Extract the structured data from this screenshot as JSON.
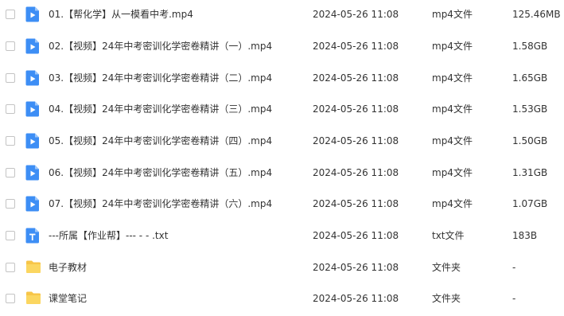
{
  "files": [
    {
      "name": "01.【帮化学】从一模看中考.mp4",
      "date": "2024-05-26 11:08",
      "type": "mp4文件",
      "size": "125.46MB",
      "icon": "video-file-icon"
    },
    {
      "name": "02.【视频】24年中考密训化学密卷精讲（一）.mp4",
      "date": "2024-05-26 11:08",
      "type": "mp4文件",
      "size": "1.58GB",
      "icon": "video-file-icon"
    },
    {
      "name": "03.【视频】24年中考密训化学密卷精讲（二）.mp4",
      "date": "2024-05-26 11:08",
      "type": "mp4文件",
      "size": "1.65GB",
      "icon": "video-file-icon"
    },
    {
      "name": "04.【视频】24年中考密训化学密卷精讲（三）.mp4",
      "date": "2024-05-26 11:08",
      "type": "mp4文件",
      "size": "1.53GB",
      "icon": "video-file-icon"
    },
    {
      "name": "05.【视频】24年中考密训化学密卷精讲（四）.mp4",
      "date": "2024-05-26 11:08",
      "type": "mp4文件",
      "size": "1.50GB",
      "icon": "video-file-icon"
    },
    {
      "name": "06.【视频】24年中考密训化学密卷精讲（五）.mp4",
      "date": "2024-05-26 11:08",
      "type": "mp4文件",
      "size": "1.31GB",
      "icon": "video-file-icon"
    },
    {
      "name": "07.【视频】24年中考密训化学密卷精讲（六）.mp4",
      "date": "2024-05-26 11:08",
      "type": "mp4文件",
      "size": "1.07GB",
      "icon": "video-file-icon"
    },
    {
      "name": "---所属【作业帮】--- - - .txt",
      "date": "2024-05-26 11:08",
      "type": "txt文件",
      "size": "183B",
      "icon": "text-file-icon"
    },
    {
      "name": "电子教材",
      "date": "2024-05-26 11:08",
      "type": "文件夹",
      "size": "-",
      "icon": "folder-icon"
    },
    {
      "name": "课堂笔记",
      "date": "2024-05-26 11:08",
      "type": "文件夹",
      "size": "-",
      "icon": "folder-icon"
    }
  ],
  "colors": {
    "video_icon": "#3d8ef5",
    "text_icon": "#3d8ef5",
    "folder_icon": "#f7c548"
  }
}
